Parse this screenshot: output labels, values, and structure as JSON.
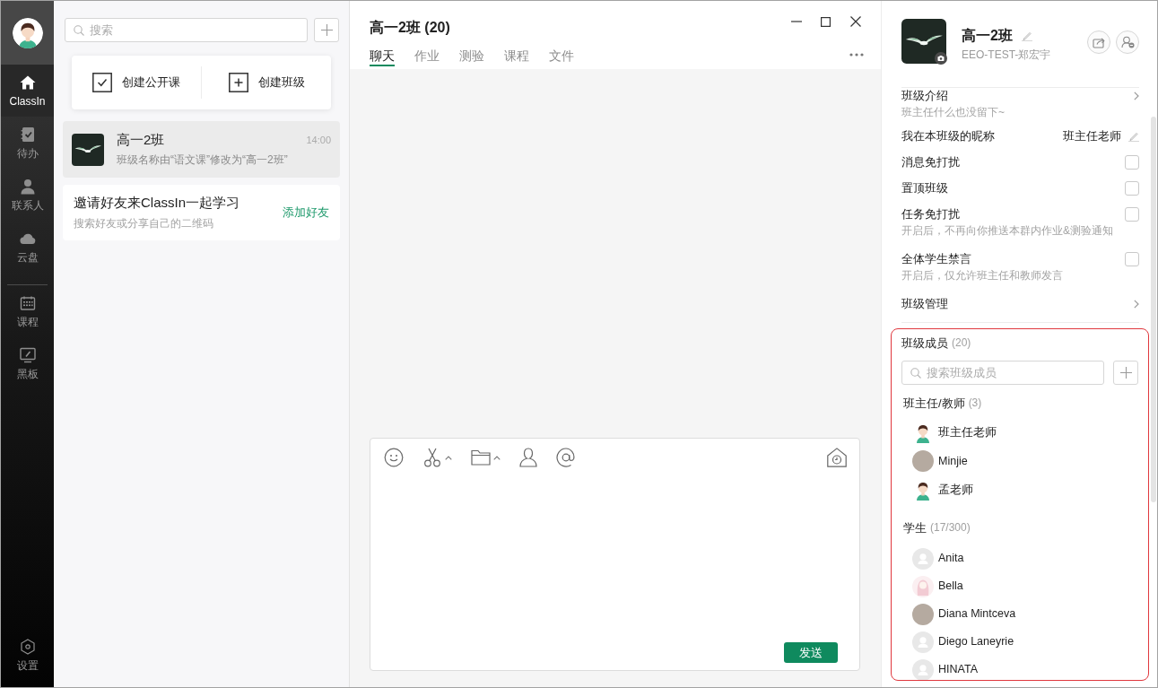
{
  "sidebar": {
    "main_items": [
      {
        "label": "ClassIn",
        "selected": true
      },
      {
        "label": "待办",
        "selected": false
      },
      {
        "label": "联系人",
        "selected": false
      },
      {
        "label": "云盘",
        "selected": false
      }
    ],
    "tool_items": [
      {
        "label": "课程",
        "selected": false
      },
      {
        "label": "黑板",
        "selected": false
      }
    ],
    "settings": {
      "label": "设置"
    }
  },
  "conversation_list": {
    "search": {
      "placeholder": "搜索"
    },
    "quick_actions": [
      {
        "label": "创建公开课"
      },
      {
        "label": "创建班级"
      }
    ],
    "conversations": [
      {
        "title": "高一2班",
        "time": "14:00",
        "preview": "班级名称由“语文课”修改为“高一2班”",
        "selected": true
      }
    ],
    "invite": {
      "title": "邀请好友来ClassIn一起学习",
      "subtitle": "搜索好友或分享自己的二维码",
      "action": "添加好友"
    }
  },
  "chat": {
    "title": "高一2班 (20)",
    "tabs": [
      {
        "label": "聊天",
        "selected": true
      },
      {
        "label": "作业",
        "selected": false
      },
      {
        "label": "测验",
        "selected": false
      },
      {
        "label": "课程",
        "selected": false
      },
      {
        "label": "文件",
        "selected": false
      }
    ],
    "composer": {
      "send_label": "发送"
    }
  },
  "class_info": {
    "name": "高一2班",
    "owner": "EEO-TEST-郑宏宇",
    "settings": [
      {
        "kind": "link",
        "label": "班级介绍",
        "subtitle": "班主任什么也没留下~"
      },
      {
        "kind": "nickname",
        "label": "我在本班级的昵称",
        "value": "班主任老师"
      },
      {
        "kind": "toggle",
        "label": "消息免打扰",
        "checked": false
      },
      {
        "kind": "toggle",
        "label": "置顶班级",
        "checked": false
      },
      {
        "kind": "toggle",
        "label": "任务免打扰",
        "subtitle": "开启后，不再向你推送本群内作业&测验通知",
        "checked": false
      },
      {
        "kind": "toggle",
        "label": "全体学生禁言",
        "subtitle": "开启后，仅允许班主任和教师发言",
        "checked": false
      },
      {
        "kind": "link",
        "label": "班级管理"
      }
    ],
    "members": {
      "title": "班级成员",
      "count": "(20)",
      "search": {
        "placeholder": "搜索班级成员"
      },
      "groups": [
        {
          "title": "班主任/教师",
          "count": "(3)",
          "members": [
            {
              "name": "班主任老师",
              "kind": "cartoon"
            },
            {
              "name": "Minjie",
              "kind": "photo"
            },
            {
              "name": "孟老师",
              "kind": "cartoon"
            }
          ]
        },
        {
          "title": "学生",
          "count": "(17/300)",
          "members": [
            {
              "name": "Anita",
              "kind": "default"
            },
            {
              "name": "Bella",
              "kind": "sketch"
            },
            {
              "name": "Diana Mintceva",
              "kind": "photo"
            },
            {
              "name": "Diego Laneyrie",
              "kind": "default"
            },
            {
              "name": "HINATA",
              "kind": "default"
            }
          ]
        }
      ]
    }
  }
}
